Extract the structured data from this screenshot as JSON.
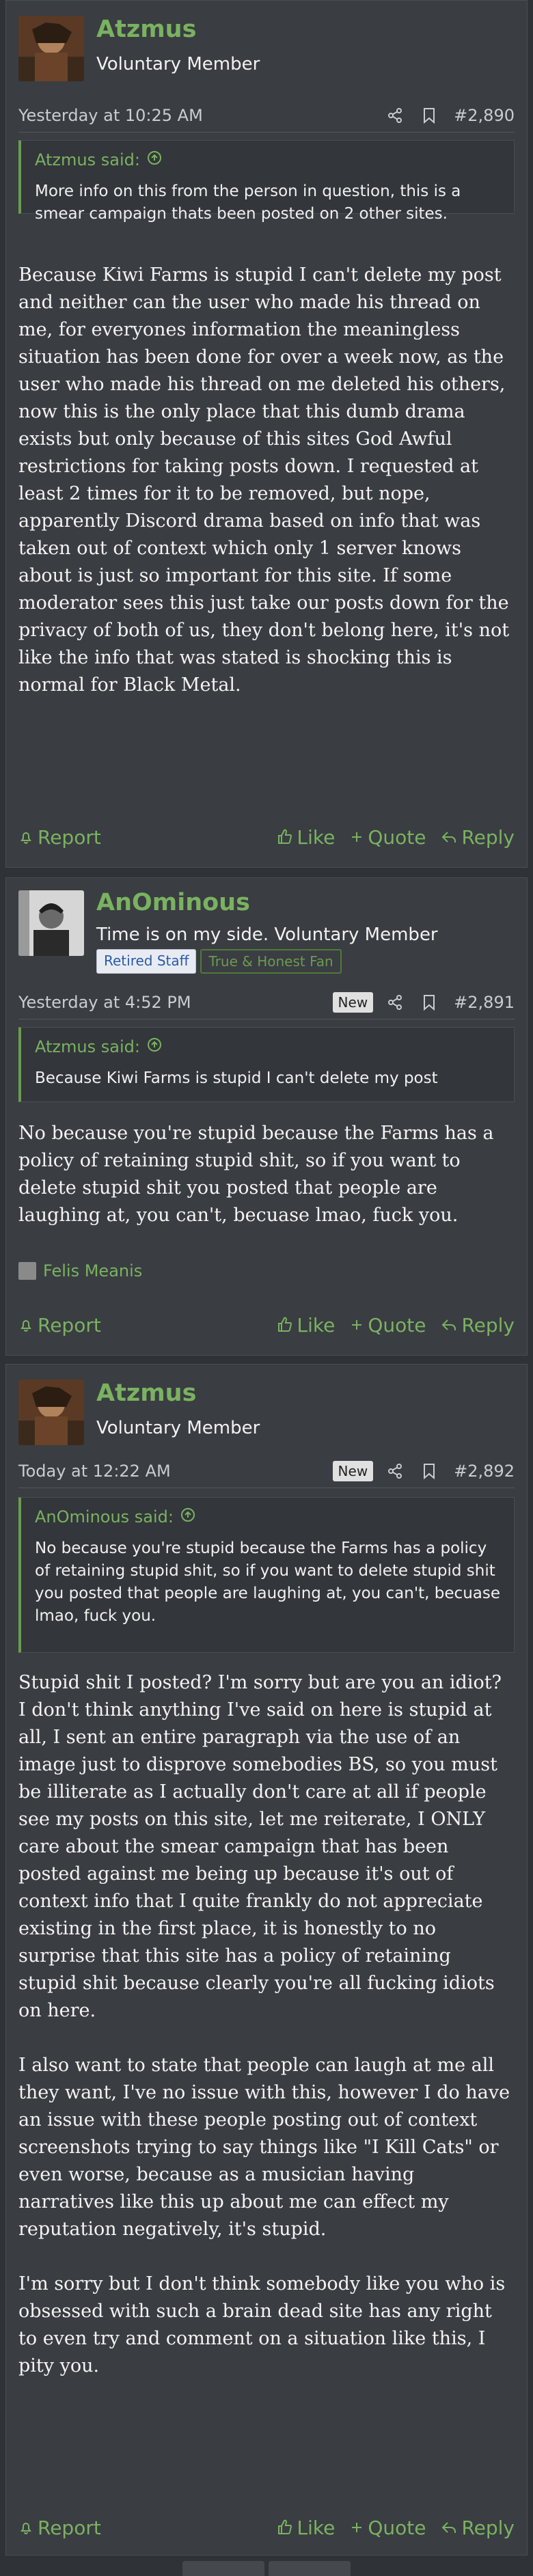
{
  "colors": {
    "accent": "#7ab260",
    "background": "#2f3237",
    "post_bg": "#3a3d42"
  },
  "actions": {
    "report": "Report",
    "like": "Like",
    "quote": "Quote",
    "reply": "Reply"
  },
  "posts": [
    {
      "username": "Atzmus",
      "user_title": "Voluntary Member",
      "timestamp": "Yesterday at 10:25 AM",
      "post_number": "#2,890",
      "quote": {
        "author": "Atzmus said:",
        "text": "More info on this from the person in question, this is a smear campaign thats been posted on 2 other sites."
      },
      "paragraphs": [
        "Because Kiwi Farms is stupid I can't delete my post and neither can the user who made his thread on me, for everyones information the meaningless situation has been done for over a week now, as the user who made his thread on me deleted his others, now this is the only place that this dumb drama exists but only because of this sites God Awful restrictions for taking posts down. I requested at least 2 times for it to be removed, but nope, apparently Discord drama based on info that was taken out of context which only 1 server knows about is just so important for this site. If some moderator sees this just take our posts down for the privacy of both of us, they don't belong here, it's not like the info that was stated is shocking this is normal for Black Metal."
      ]
    },
    {
      "username": "AnOminous",
      "user_title": "Time is on my side. Voluntary Member",
      "badges": [
        "Retired Staff",
        "True & Honest Fan"
      ],
      "timestamp": "Yesterday at 4:52 PM",
      "new_label": "New",
      "post_number": "#2,891",
      "quote": {
        "author": "Atzmus said:",
        "text": "Because Kiwi Farms is stupid I can't delete my post"
      },
      "paragraphs": [
        "No because you're stupid because the Farms has a policy of retaining stupid shit, so if you want to delete stupid shit you posted that people are laughing at, you can't, becuase lmao, fuck you."
      ],
      "reactor": "Felis Meanis"
    },
    {
      "username": "Atzmus",
      "user_title": "Voluntary Member",
      "timestamp": "Today at 12:22 AM",
      "new_label": "New",
      "post_number": "#2,892",
      "quote": {
        "author": "AnOminous said:",
        "text": "No because you're stupid because the Farms has a policy of retaining stupid shit, so if you want to delete stupid shit you posted that people are laughing at, you can't, becuase lmao, fuck you."
      },
      "paragraphs": [
        "Stupid shit I posted? I'm sorry but are you an idiot? I don't think anything I've said on here is stupid at all, I sent an entire paragraph via the use of an image just to disprove somebodies BS, so you must be illiterate as I actually don't care at all if people see my posts on this site, let me reiterate, I ONLY care about the smear campaign that has been posted against me being up because it's out of context info that I quite frankly do not appreciate existing in the first place, it is honestly to no surprise that this site has a policy of retaining stupid shit because clearly you're all fucking idiots on here.",
        "I also want to state that people can laugh at me all they want, I've no issue with this, however I do have an issue with these people posting out of context screenshots trying to say things like \"I Kill Cats\" or even worse, because as a musician having narratives like this up about me can effect my reputation negatively, it's stupid.",
        "I'm sorry but I don't think somebody like you who is obsessed with such a brain dead site has any right to even try and comment on a situation like this, I pity you."
      ]
    }
  ]
}
